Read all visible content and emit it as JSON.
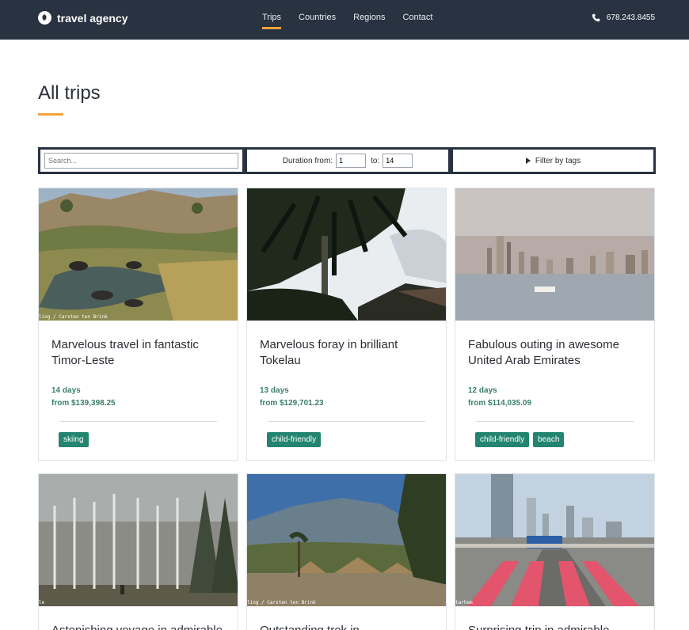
{
  "brand": {
    "name": "travel agency",
    "icon": "compass-icon"
  },
  "nav": {
    "items": [
      {
        "label": "Trips",
        "active": true
      },
      {
        "label": "Countries",
        "active": false
      },
      {
        "label": "Regions",
        "active": false
      },
      {
        "label": "Contact",
        "active": false
      }
    ]
  },
  "phone": {
    "number": "678.243.8455",
    "icon": "phone-icon"
  },
  "page": {
    "title": "All trips"
  },
  "filters": {
    "search_placeholder": "Search...",
    "duration_label": "Duration from:",
    "duration_from": "1",
    "to_label": "to:",
    "duration_to": "14",
    "tags_label": "Filter by tags"
  },
  "trips": [
    {
      "title": "Marvelous travel in fantastic Timor-Leste",
      "days": "14 days",
      "price": "from $139,398.25",
      "tags": [
        "skiing"
      ],
      "caption": "ling / Carsten ten Brink"
    },
    {
      "title": "Marvelous foray in brilliant Tokelau",
      "days": "13 days",
      "price": "from $129,701.23",
      "tags": [
        "child-friendly"
      ],
      "caption": ""
    },
    {
      "title": "Fabulous outing in awesome United Arab Emirates",
      "days": "12 days",
      "price": "from $114,035.09",
      "tags": [
        "child-friendly",
        "beach"
      ],
      "caption": ""
    },
    {
      "title": "Astonishing voyage in admirable",
      "caption": "le"
    },
    {
      "title": "Outstanding trek in",
      "caption": "ling / Carsten ten Brink"
    },
    {
      "title": "Surprising trip in admirable",
      "caption": "tarhem"
    }
  ],
  "colors": {
    "header": "#283240",
    "accent": "#f0a43a",
    "tag": "#238570"
  }
}
